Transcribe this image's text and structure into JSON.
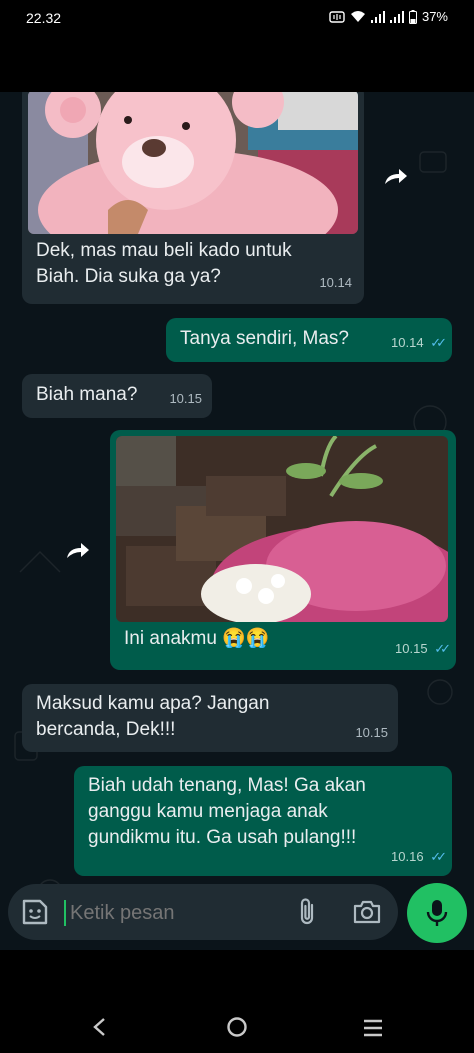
{
  "status": {
    "time": "22.32",
    "battery": "37%"
  },
  "messages": [
    {
      "text": "Dek, mas mau beli kado untuk Biah. Dia suka ga ya?",
      "time": "10.14"
    },
    {
      "text": "Tanya sendiri, Mas?",
      "time": "10.14"
    },
    {
      "text": "Biah mana?",
      "time": "10.15"
    },
    {
      "text": "Ini anakmu",
      "emoji": "😭😭",
      "time": "10.15"
    },
    {
      "text": "Maksud kamu apa? Jangan bercanda, Dek!!!",
      "time": "10.15"
    },
    {
      "text": "Biah udah tenang, Mas! Ga akan ganggu kamu menjaga anak gundikmu itu. Ga usah pulang!!!",
      "time": "10.16"
    }
  ],
  "composer": {
    "placeholder": "Ketik pesan"
  },
  "icons": {
    "forward": "forward-icon",
    "read_ticks": "double-check-icon",
    "sticker": "sticker-icon",
    "attach": "paperclip-icon",
    "camera": "camera-icon",
    "mic": "mic-icon",
    "back": "nav-back-icon",
    "home": "nav-home-icon",
    "recents": "nav-recents-icon"
  },
  "colors": {
    "chat_bg": "#0b141a",
    "incoming_bubble": "#202c33",
    "outgoing_bubble": "#005c4b",
    "read_tick": "#53bdeb",
    "mic_button": "#21c063"
  }
}
